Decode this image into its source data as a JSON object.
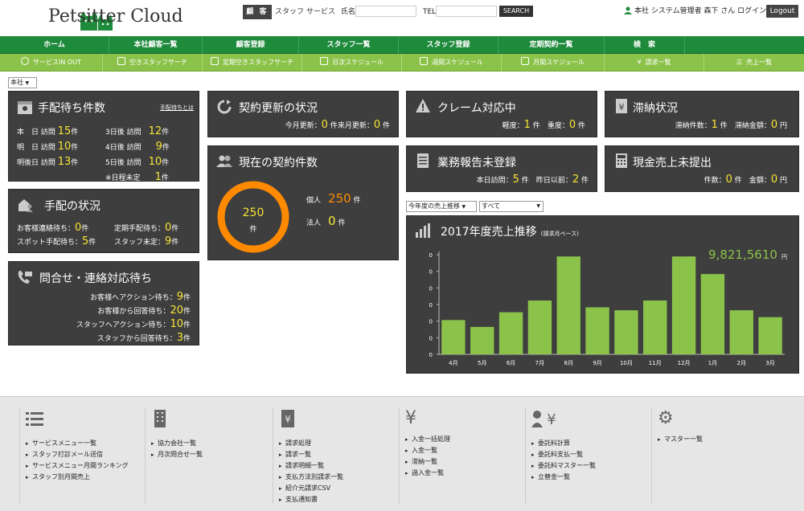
{
  "header": {
    "app_name": "Petsitter Cloud",
    "segments": [
      "顧 客",
      "スタッフ",
      "サービス"
    ],
    "name_label": "氏名",
    "tel_label": "TEL",
    "search_label": "SEARCH",
    "user_info": "本社 システム管理者 森下 さん ログイン中",
    "logout_label": "Logout"
  },
  "nav": {
    "items": [
      "ホーム",
      "本社顧客一覧",
      "顧客登録",
      "スタッフ一覧",
      "スタッフ登録",
      "定期契約一覧",
      "検　索"
    ]
  },
  "subnav": {
    "items": [
      "サービスIN OUT",
      "空きスタッフサーチ",
      "定期空きスタッフサーチ",
      "日次スケジュール",
      "週間スケジュール",
      "月間スケジュール",
      "請求一覧",
      "売上一覧"
    ]
  },
  "branch_select": "本社",
  "tehai_machi": {
    "title": "手配待ち件数",
    "help": "手配待ちとは",
    "rows_left": [
      {
        "label": "本　日 訪問",
        "value": "15",
        "unit": "件"
      },
      {
        "label": "明　日 訪問",
        "value": "10",
        "unit": "件"
      },
      {
        "label": "明後日 訪問",
        "value": "13",
        "unit": "件"
      }
    ],
    "rows_right": [
      {
        "label": "3日後 訪問",
        "value": "12",
        "unit": "件"
      },
      {
        "label": "4日後 訪問",
        "value": "9",
        "unit": "件"
      },
      {
        "label": "5日後 訪問",
        "value": "10",
        "unit": "件"
      },
      {
        "label": "※日程未定",
        "value": "1",
        "unit": "件"
      }
    ]
  },
  "tehai_jokyo": {
    "title": "手配の状況",
    "r1a_label": "お客様連絡待ち：",
    "r1a_value": "0",
    "r1a_unit": "件",
    "r1b_label": "定期手配待ち：",
    "r1b_value": "0",
    "r1b_unit": "件",
    "r2a_label": "スポット手配待ち：",
    "r2a_value": "5",
    "r2a_unit": "件",
    "r2b_label": "スタッフ未定：",
    "r2b_value": "9",
    "r2b_unit": "件"
  },
  "toiawase": {
    "title": "問合せ・連絡対応待ち",
    "rows": [
      {
        "label": "お客様へアクション待ち：",
        "value": "9",
        "unit": "件"
      },
      {
        "label": "お客様から回答待ち：",
        "value": "20",
        "unit": "件"
      },
      {
        "label": "スタッフへアクション待ち：",
        "value": "10",
        "unit": "件"
      },
      {
        "label": "スタッフから回答待ち：",
        "value": "3",
        "unit": "件"
      }
    ]
  },
  "keiyaku_koshin": {
    "title": "契約更新の状況",
    "l1": "今月更新：",
    "v1": "0",
    "u1": "件",
    "l2": "来月更新：",
    "v2": "0",
    "u2": "件"
  },
  "keiyaku_count": {
    "title": "現在の契約件数",
    "total": "250",
    "total_unit": "件",
    "kojin_label": "個人",
    "kojin_value": "250",
    "kojin_unit": "件",
    "hojin_label": "法人",
    "hojin_value": "0",
    "hojin_unit": "件"
  },
  "claim": {
    "title": "クレーム対応中",
    "l1": "軽度：",
    "v1": "1",
    "u1": "件",
    "l2": "重度：",
    "v2": "0",
    "u2": "件"
  },
  "gyomu": {
    "title": "業務報告未登録",
    "l1": "本日訪問：",
    "v1": "5",
    "u1": "件",
    "l2": "昨日以前：",
    "v2": "2",
    "u2": "件"
  },
  "tainou": {
    "title": "滞納状況",
    "l1": "滞納件数：",
    "v1": "1",
    "u1": "件",
    "l2": "滞納金額：",
    "v2": "0",
    "u2": "円"
  },
  "genkin": {
    "title": "現金売上未提出",
    "l1": "件数：",
    "v1": "0",
    "u1": "件",
    "l2": "金額：",
    "v2": "0",
    "u2": "円"
  },
  "chart_controls": {
    "select1": "今年度の売上推移",
    "select2": "すべて"
  },
  "chart_data": {
    "type": "bar",
    "title": "2017年度売上推移",
    "subtitle": "(請求月ベース)",
    "total": "9,821,5610",
    "total_unit": "円",
    "categories": [
      "4月",
      "5月",
      "6月",
      "7月",
      "8月",
      "9月",
      "10月",
      "11月",
      "12月",
      "1月",
      "2月",
      "3月"
    ],
    "values": [
      35,
      28,
      43,
      55,
      100,
      48,
      45,
      55,
      100,
      82,
      45,
      38
    ],
    "y_tick_labels": [
      "0",
      "0",
      "0",
      "0",
      "0",
      "0",
      "0"
    ],
    "ylim": [
      0,
      110
    ]
  },
  "footer": {
    "col1": [
      "サービスメニュー一覧",
      "スタッフ打診メール送信",
      "サービスメニュー月間ランキング",
      "スタッフ別月間売上"
    ],
    "col2": [
      "協力会社一覧",
      "月次問合せ一覧"
    ],
    "col3": [
      "請求処理",
      "請求一覧",
      "請求明細一覧",
      "支払方法別請求一覧",
      "紹介元請求CSV",
      "支払通知書"
    ],
    "col4": [
      "入金一括処理",
      "入金一覧",
      "滞納一覧",
      "過入金一覧"
    ],
    "col5": [
      "委託料計算",
      "委託料支払一覧",
      "委託料マスター一覧",
      "立替金一覧"
    ],
    "col6": [
      "マスター一覧"
    ]
  },
  "colors": {
    "nav": "#1e8a3b",
    "subnav": "#8bc34a",
    "panel": "#3e3e3e",
    "accent_yellow": "#f7e436",
    "accent_orange": "#ff8a00",
    "bar": "#8bc34a"
  }
}
